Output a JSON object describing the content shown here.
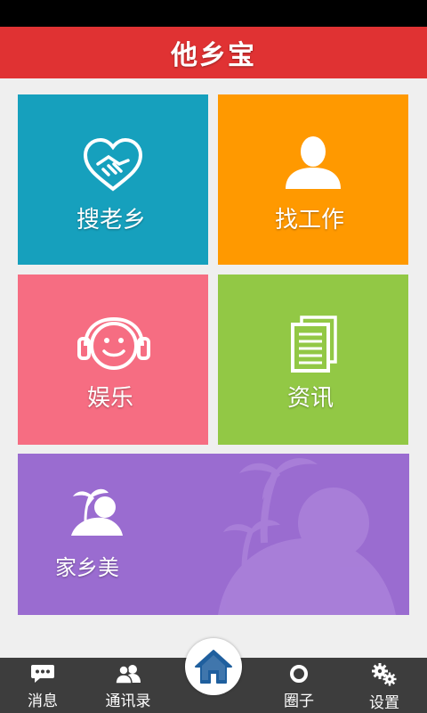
{
  "app": {
    "title": "他乡宝"
  },
  "tiles": [
    {
      "label": "搜老乡",
      "color": "#16a0bd",
      "icon": "heart-handshake-icon"
    },
    {
      "label": "找工作",
      "color": "#ff9900",
      "icon": "person-icon"
    },
    {
      "label": "娱乐",
      "color": "#f66d82",
      "icon": "smiley-headphones-icon"
    },
    {
      "label": "资讯",
      "color": "#92c845",
      "icon": "documents-icon"
    },
    {
      "label": "家乡美",
      "color": "#9a6cd0",
      "icon": "island-palm-icon"
    }
  ],
  "tabbar": {
    "items": [
      {
        "label": "消息",
        "icon": "chat-bubble-icon"
      },
      {
        "label": "通讯录",
        "icon": "contacts-icon"
      },
      {
        "label": "圈子",
        "icon": "circle-icon"
      },
      {
        "label": "设置",
        "icon": "gears-icon"
      }
    ],
    "home_icon": "home-icon"
  }
}
